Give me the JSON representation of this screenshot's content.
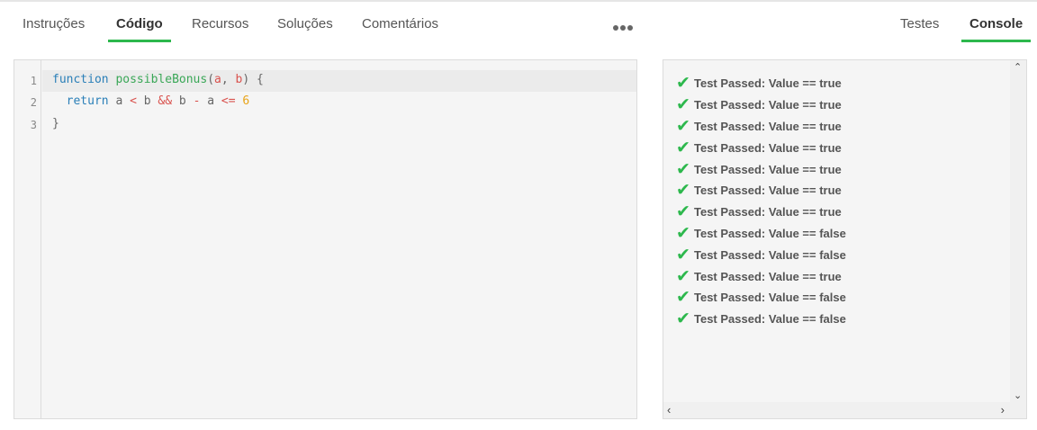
{
  "left_tabs": [
    {
      "label": "Instruções",
      "active": false
    },
    {
      "label": "Código",
      "active": true
    },
    {
      "label": "Recursos",
      "active": false
    },
    {
      "label": "Soluções",
      "active": false
    },
    {
      "label": "Comentários",
      "active": false
    }
  ],
  "right_tabs": [
    {
      "label": "Testes",
      "active": false
    },
    {
      "label": "Console",
      "active": true
    }
  ],
  "more_icon": "ellipsis-icon",
  "editor": {
    "line_numbers": [
      "1",
      "2",
      "3"
    ],
    "lines": [
      [
        {
          "t": "function",
          "c": "kw"
        },
        {
          "t": " ",
          "c": ""
        },
        {
          "t": "possibleBonus",
          "c": "fn"
        },
        {
          "t": "(",
          "c": ""
        },
        {
          "t": "a",
          "c": "op"
        },
        {
          "t": ", ",
          "c": ""
        },
        {
          "t": "b",
          "c": "op"
        },
        {
          "t": ") {",
          "c": ""
        }
      ],
      [
        {
          "t": "  ",
          "c": ""
        },
        {
          "t": "return",
          "c": "kw"
        },
        {
          "t": " a ",
          "c": ""
        },
        {
          "t": "<",
          "c": "op"
        },
        {
          "t": " b ",
          "c": ""
        },
        {
          "t": "&&",
          "c": "op"
        },
        {
          "t": " b ",
          "c": ""
        },
        {
          "t": "-",
          "c": "op"
        },
        {
          "t": " a ",
          "c": ""
        },
        {
          "t": "<=",
          "c": "op"
        },
        {
          "t": " ",
          "c": ""
        },
        {
          "t": "6",
          "c": "num"
        }
      ],
      [
        {
          "t": "}",
          "c": ""
        }
      ]
    ]
  },
  "console": {
    "check_icon": "check-icon",
    "messages": [
      "Test Passed: Value == true",
      "Test Passed: Value == true",
      "Test Passed: Value == true",
      "Test Passed: Value == true",
      "Test Passed: Value == true",
      "Test Passed: Value == true",
      "Test Passed: Value == true",
      "Test Passed: Value == false",
      "Test Passed: Value == false",
      "Test Passed: Value == true",
      "Test Passed: Value == false",
      "Test Passed: Value == false"
    ]
  },
  "colors": {
    "accent": "#2db84d",
    "keyword": "#2a7fb8",
    "function_name": "#3aa757",
    "operator": "#d9534f",
    "number": "#e8a317"
  }
}
